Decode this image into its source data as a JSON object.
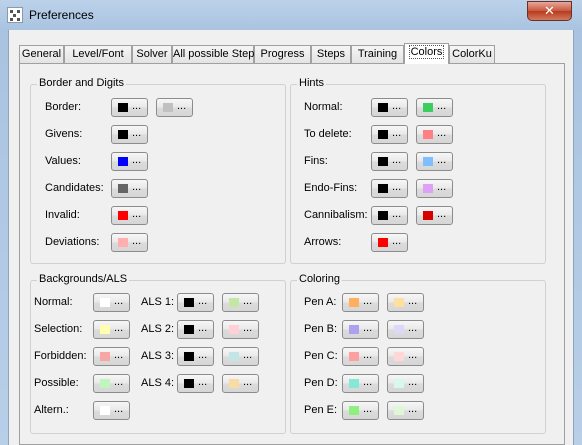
{
  "window": {
    "title": "Preferences",
    "close_label": "✕"
  },
  "tabs": [
    "General",
    "Level/Font",
    "Solver",
    "All possible Steps",
    "Progress",
    "Steps",
    "Training",
    "Colors",
    "ColorKu"
  ],
  "selected_tab": "Colors",
  "groups": {
    "border_digits": "Border and Digits",
    "hints": "Hints",
    "backgrounds": "Backgrounds/ALS",
    "coloring": "Coloring"
  },
  "button_text": "...",
  "border_digits": [
    {
      "label": "Border:",
      "colors": [
        "#000000",
        "#c0c0c0"
      ]
    },
    {
      "label": "Givens:",
      "colors": [
        "#000000"
      ]
    },
    {
      "label": "Values:",
      "colors": [
        "#0000ff"
      ]
    },
    {
      "label": "Candidates:",
      "colors": [
        "#646464"
      ]
    },
    {
      "label": "Invalid:",
      "colors": [
        "#ff0000"
      ]
    },
    {
      "label": "Deviations:",
      "colors": [
        "#ffafaf"
      ]
    }
  ],
  "hints": [
    {
      "label": "Normal:",
      "colors": [
        "#000000",
        "#3ccd5f"
      ]
    },
    {
      "label": "To delete:",
      "colors": [
        "#000000",
        "#ff7f87"
      ]
    },
    {
      "label": "Fins:",
      "colors": [
        "#000000",
        "#7fbfff"
      ]
    },
    {
      "label": "Endo-Fins:",
      "colors": [
        "#000000",
        "#dfa0f7"
      ]
    },
    {
      "label": "Cannibalism:",
      "colors": [
        "#000000",
        "#d40000"
      ]
    },
    {
      "label": "Arrows:",
      "colors": [
        "#ff0000"
      ]
    }
  ],
  "backgrounds": [
    {
      "label": "Normal:",
      "color": "#ffffff",
      "als_label": "ALS 1:",
      "als_colors": [
        "#000000",
        "#c5e7a5"
      ]
    },
    {
      "label": "Selection:",
      "color": "#ffffaf",
      "als_label": "ALS 2:",
      "als_colors": [
        "#000000",
        "#ffd0d5"
      ]
    },
    {
      "label": "Forbidden:",
      "color": "#f7a5a5",
      "als_label": "ALS 3:",
      "als_colors": [
        "#000000",
        "#c3e5e5"
      ]
    },
    {
      "label": "Possible:",
      "color": "#c0f5c0",
      "als_label": "ALS 4:",
      "als_colors": [
        "#000000",
        "#f7dda5"
      ]
    },
    {
      "label": "Altern.:",
      "color": "#ffffff"
    }
  ],
  "coloring": [
    {
      "label": "Pen A:",
      "colors": [
        "#ffaf5f",
        "#ffdf9f"
      ]
    },
    {
      "label": "Pen B:",
      "colors": [
        "#af9fef",
        "#dfd7f7"
      ]
    },
    {
      "label": "Pen C:",
      "colors": [
        "#ffa0a0",
        "#ffd7d7"
      ]
    },
    {
      "label": "Pen D:",
      "colors": [
        "#87e7d7",
        "#d7f7ef"
      ]
    },
    {
      "label": "Pen E:",
      "colors": [
        "#8fef7f",
        "#dff7d7"
      ]
    }
  ]
}
